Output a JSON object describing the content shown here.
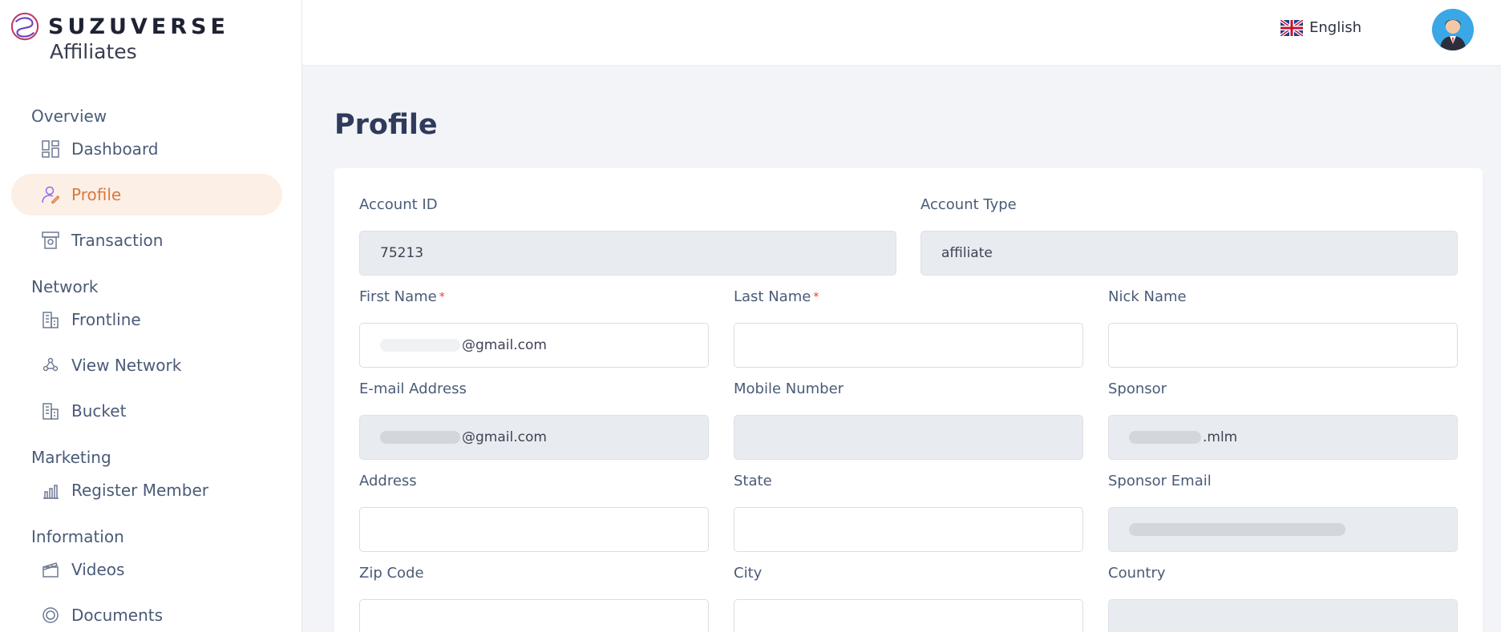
{
  "brand": {
    "name": "SUZUVERSE",
    "subtitle": "Affiliates"
  },
  "sidebar": {
    "sections": [
      {
        "title": "Overview",
        "items": [
          {
            "label": "Dashboard",
            "icon": "dashboard-icon"
          },
          {
            "label": "Profile",
            "icon": "user-edit-icon",
            "active": true
          },
          {
            "label": "Transaction",
            "icon": "atm-icon"
          }
        ]
      },
      {
        "title": "Network",
        "items": [
          {
            "label": "Frontline",
            "icon": "building-icon"
          },
          {
            "label": "View Network",
            "icon": "network-icon"
          },
          {
            "label": "Bucket",
            "icon": "building-icon"
          }
        ]
      },
      {
        "title": "Marketing",
        "items": [
          {
            "label": "Register Member",
            "icon": "chart-icon"
          }
        ]
      },
      {
        "title": "Information",
        "items": [
          {
            "label": "Videos",
            "icon": "video-icon"
          },
          {
            "label": "Documents",
            "icon": "document-icon"
          }
        ]
      }
    ]
  },
  "header": {
    "language": "English"
  },
  "page": {
    "title": "Profile"
  },
  "form": {
    "account_id": {
      "label": "Account ID",
      "value": "75213"
    },
    "account_type": {
      "label": "Account Type",
      "value": "affiliate"
    },
    "first_name": {
      "label": "First Name",
      "required_mark": "*",
      "value": "@gmail.com"
    },
    "last_name": {
      "label": "Last Name",
      "required_mark": "*",
      "value": ""
    },
    "nick_name": {
      "label": "Nick Name",
      "value": ""
    },
    "email": {
      "label": "E-mail Address",
      "value": "@gmail.com"
    },
    "mobile": {
      "label": "Mobile Number",
      "value": ""
    },
    "sponsor": {
      "label": "Sponsor",
      "value": ".mlm"
    },
    "address": {
      "label": "Address",
      "value": ""
    },
    "state": {
      "label": "State",
      "value": ""
    },
    "sponsor_email": {
      "label": "Sponsor Email",
      "value": ""
    },
    "zip": {
      "label": "Zip Code",
      "value": ""
    },
    "city": {
      "label": "City",
      "value": ""
    },
    "country": {
      "label": "Country",
      "value": ""
    }
  },
  "colors": {
    "accent": "#d77a3e",
    "active_bg": "#fcefe6",
    "readonly_bg": "#e8ebef",
    "title": "#2f3a5c"
  }
}
